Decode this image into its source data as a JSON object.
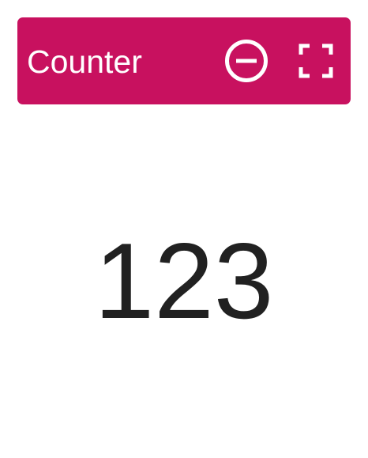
{
  "toolbar": {
    "title": "Counter",
    "background_color": "#c8115f",
    "decrement_icon": "minus-circle-icon",
    "fullscreen_icon": "fullscreen-icon"
  },
  "counter": {
    "value": "123",
    "text_color": "#212121"
  }
}
